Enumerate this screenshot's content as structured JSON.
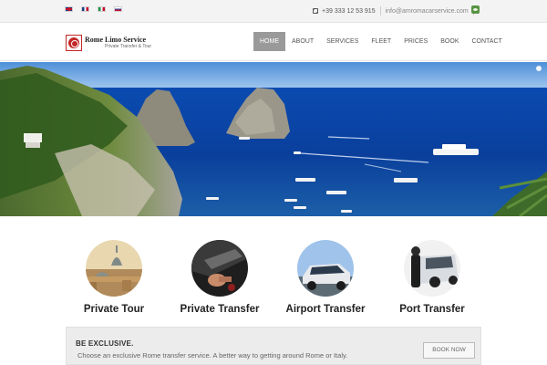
{
  "topbar": {
    "languages": [
      "English",
      "Français",
      "Italiano",
      "Русский"
    ],
    "phone": "+39 333 12 53 915",
    "email": "info@amromacarservice.com"
  },
  "header": {
    "logo_name": "Rome Limo Service",
    "logo_tagline": "Private Transfer & Tour",
    "nav": [
      {
        "label": "Home",
        "active": true
      },
      {
        "label": "About",
        "active": false
      },
      {
        "label": "Services",
        "active": false
      },
      {
        "label": "Fleet",
        "active": false
      },
      {
        "label": "Prices",
        "active": false
      },
      {
        "label": "Book",
        "active": false
      },
      {
        "label": "Contact",
        "active": false
      }
    ]
  },
  "services": [
    {
      "title": "Private Tour",
      "icon": "rome-dome-photo"
    },
    {
      "title": "Private Transfer",
      "icon": "driver-hand-photo"
    },
    {
      "title": "Airport Transfer",
      "icon": "car-front-photo"
    },
    {
      "title": "Port Transfer",
      "icon": "chauffeur-door-photo"
    }
  ],
  "cta": {
    "heading": "BE EXCLUSIVE.",
    "text": "Choose an exclusive Rome transfer service. A better way to getting around Rome or Italy.",
    "button": "Book now"
  },
  "colors": {
    "nav_active": "#9a9a9a",
    "logo_red": "#c32727",
    "sea": "#0b4fb5"
  }
}
